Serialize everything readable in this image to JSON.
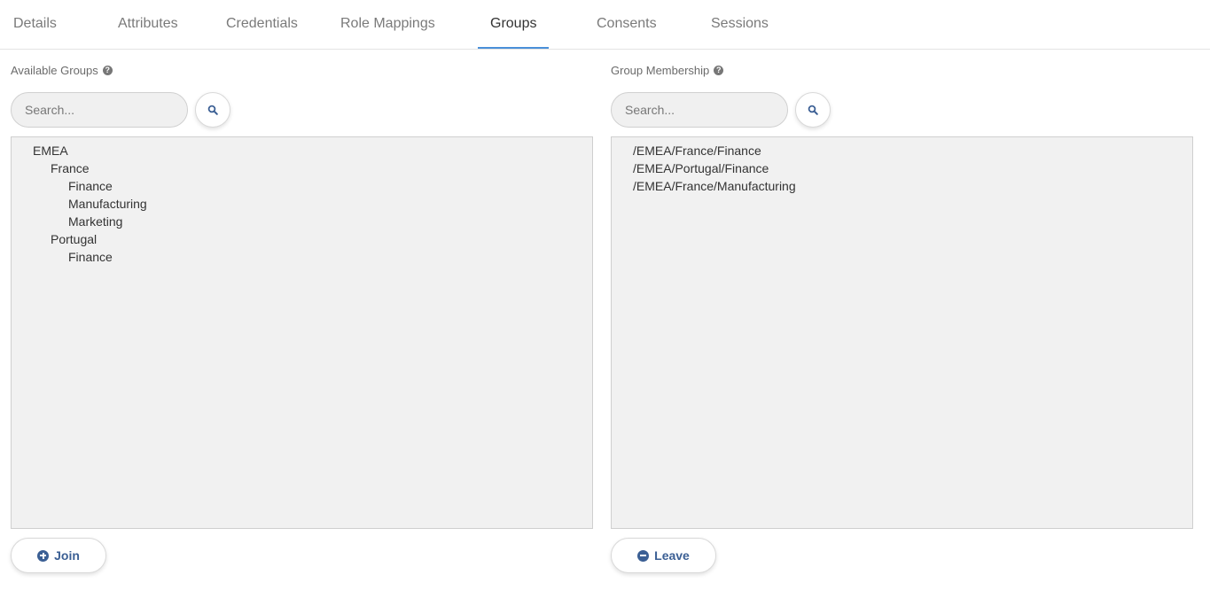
{
  "tabs": [
    {
      "label": "Details"
    },
    {
      "label": "Attributes"
    },
    {
      "label": "Credentials"
    },
    {
      "label": "Role Mappings"
    },
    {
      "label": "Groups",
      "active": true
    },
    {
      "label": "Consents"
    },
    {
      "label": "Sessions"
    }
  ],
  "available": {
    "label": "Available Groups",
    "search_placeholder": "Search...",
    "tree": [
      {
        "label": "EMEA",
        "depth": 0
      },
      {
        "label": "France",
        "depth": 1
      },
      {
        "label": "Finance",
        "depth": 2
      },
      {
        "label": "Manufacturing",
        "depth": 2
      },
      {
        "label": "Marketing",
        "depth": 2
      },
      {
        "label": "Portugal",
        "depth": 1
      },
      {
        "label": "Finance",
        "depth": 2
      }
    ],
    "button_label": "Join"
  },
  "membership": {
    "label": "Group Membership",
    "search_placeholder": "Search...",
    "items": [
      "/EMEA/France/Finance",
      "/EMEA/Portugal/Finance",
      "/EMEA/France/Manufacturing"
    ],
    "button_label": "Leave"
  },
  "colors": {
    "accent": "#4a90d9",
    "button_text": "#3b5f94",
    "list_bg": "#f1f1f1"
  }
}
